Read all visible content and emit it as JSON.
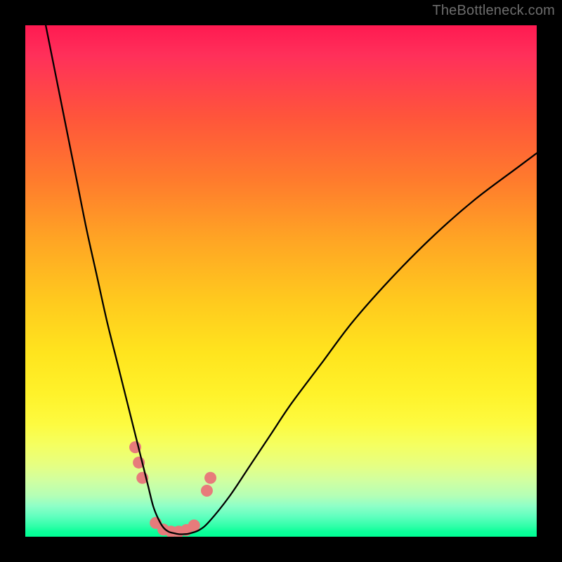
{
  "watermark": {
    "text": "TheBottleneck.com"
  },
  "chart_data": {
    "type": "line",
    "title": "",
    "xlabel": "",
    "ylabel": "",
    "xlim": [
      0,
      100
    ],
    "ylim": [
      0,
      100
    ],
    "grid": false,
    "legend": false,
    "background_gradient_stops": [
      {
        "pos": 0,
        "color": "#ff1a51"
      },
      {
        "pos": 18,
        "color": "#ff553b"
      },
      {
        "pos": 42,
        "color": "#ffa524"
      },
      {
        "pos": 64,
        "color": "#ffe41e"
      },
      {
        "pos": 82,
        "color": "#f5ff60"
      },
      {
        "pos": 94,
        "color": "#8effc7"
      },
      {
        "pos": 100,
        "color": "#00ff95"
      }
    ],
    "series": [
      {
        "name": "curve",
        "stroke": "#000000",
        "stroke_width": 2.3,
        "x": [
          4,
          6,
          8,
          10,
          12,
          14,
          16,
          18,
          20,
          21,
          22,
          23,
          24,
          25,
          26,
          27,
          28,
          29,
          30,
          31,
          32,
          34,
          36,
          40,
          44,
          48,
          52,
          58,
          64,
          72,
          80,
          88,
          96,
          100
        ],
        "y": [
          100,
          90,
          80,
          70,
          60,
          51,
          42,
          34,
          26,
          22,
          18,
          14,
          10,
          6,
          3.5,
          1.8,
          1,
          0.7,
          0.5,
          0.5,
          0.6,
          1.3,
          3,
          8,
          14,
          20,
          26,
          34,
          42,
          51,
          59,
          66,
          72,
          75
        ]
      }
    ],
    "markers": {
      "name": "beads",
      "color": "#e77b7b",
      "radius": 8.5,
      "points": [
        {
          "x": 21.5,
          "y": 17.5
        },
        {
          "x": 22.2,
          "y": 14.5
        },
        {
          "x": 22.9,
          "y": 11.5
        },
        {
          "x": 25.5,
          "y": 2.7
        },
        {
          "x": 27.0,
          "y": 1.4
        },
        {
          "x": 28.5,
          "y": 1.0
        },
        {
          "x": 30.0,
          "y": 1.0
        },
        {
          "x": 31.5,
          "y": 1.3
        },
        {
          "x": 33.0,
          "y": 2.2
        },
        {
          "x": 35.5,
          "y": 9.0
        },
        {
          "x": 36.2,
          "y": 11.5
        }
      ]
    }
  }
}
